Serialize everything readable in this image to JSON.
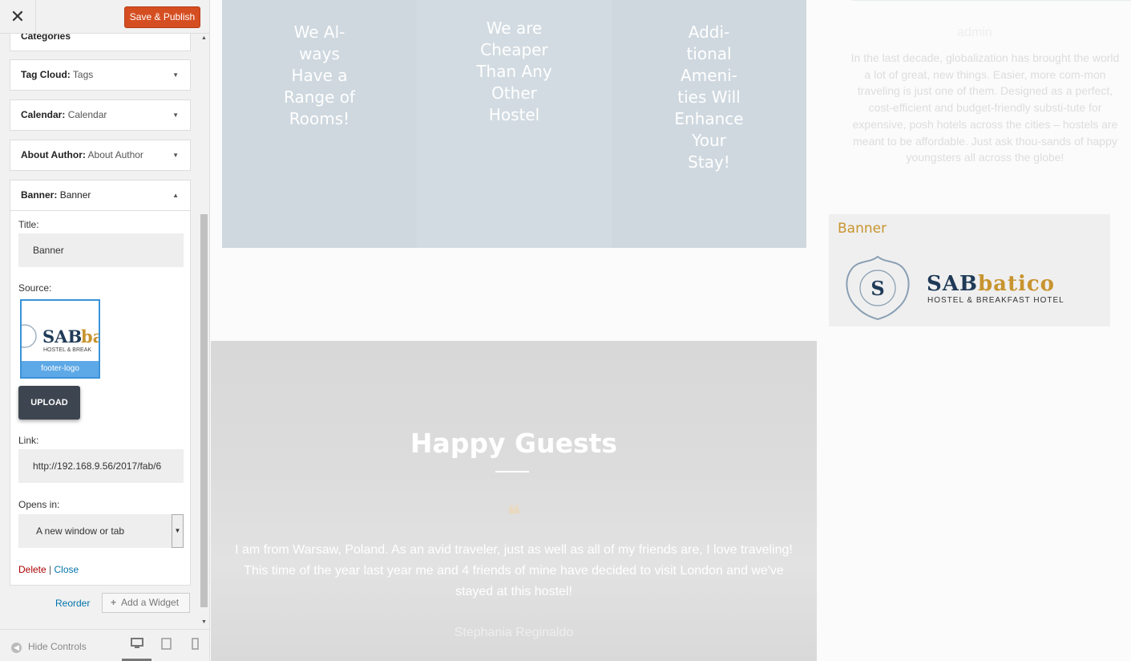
{
  "topbar": {
    "close_label": "✕",
    "save_label": "Save & Publish"
  },
  "sections": [
    {
      "type": "Categories",
      "name": ""
    },
    {
      "type": "Tag Cloud:",
      "name": "Tags"
    },
    {
      "type": "Calendar:",
      "name": "Calendar"
    },
    {
      "type": "About Author:",
      "name": "About Author"
    }
  ],
  "banner_panel": {
    "type": "Banner:",
    "name": "Banner",
    "title_label": "Title:",
    "title_value": "Banner",
    "source_label": "Source:",
    "thumb_caption": "footer-logo",
    "upload_label": "UPLOAD",
    "link_label": "Link:",
    "link_value": "http://192.168.9.56/2017/fab/6",
    "opens_label": "Opens in:",
    "opens_value": "A new window or tab",
    "delete_label": "Delete",
    "separator": "|",
    "close_label": "Close"
  },
  "footer_actions": {
    "reorder_label": "Reorder",
    "add_widget_label": "Add a Widget",
    "hide_controls_label": "Hide Controls"
  },
  "preview": {
    "features": [
      "We Al-\nways\nHave a\nRange of\nRooms!",
      "We are\nCheaper\nThan Any\nOther\nHostel",
      "Addi-\ntional\nAmeni-\nties Will\nEnhance\nYour\nStay!"
    ],
    "guests_title": "Happy Guests",
    "quote_glyph": "❝",
    "guest_quote": "I am from Warsaw, Poland. As an avid traveler, just as well as all of my friends are, I love traveling! This time of the year last year me and 4 friends of mine have decided to visit London and we've stayed at this hostel!",
    "guest_name": "Stephania Reginaldo",
    "author_title": "admin",
    "author_text": "In the last decade, globalization has brought the world a lot of great, new things. Easier, more com-mon traveling is just one of them. Designed as a perfect, cost-efficient and budget-friendly substi-tute for expensive, posh hotels across the cities – hostels are meant to be affordable. Just ask thou-sands of happy youngsters all across the globe!",
    "banner_title": "Banner",
    "logo_letter": "S",
    "logo_sab": "SAB",
    "logo_batico": "batico",
    "logo_sub": "HOSTEL & BREAKFAST HOTEL"
  },
  "colors": {
    "save": "#d54e21",
    "accent": "#c8942f",
    "navy": "#1f3a57",
    "feature_bg": "#cfd8df"
  }
}
